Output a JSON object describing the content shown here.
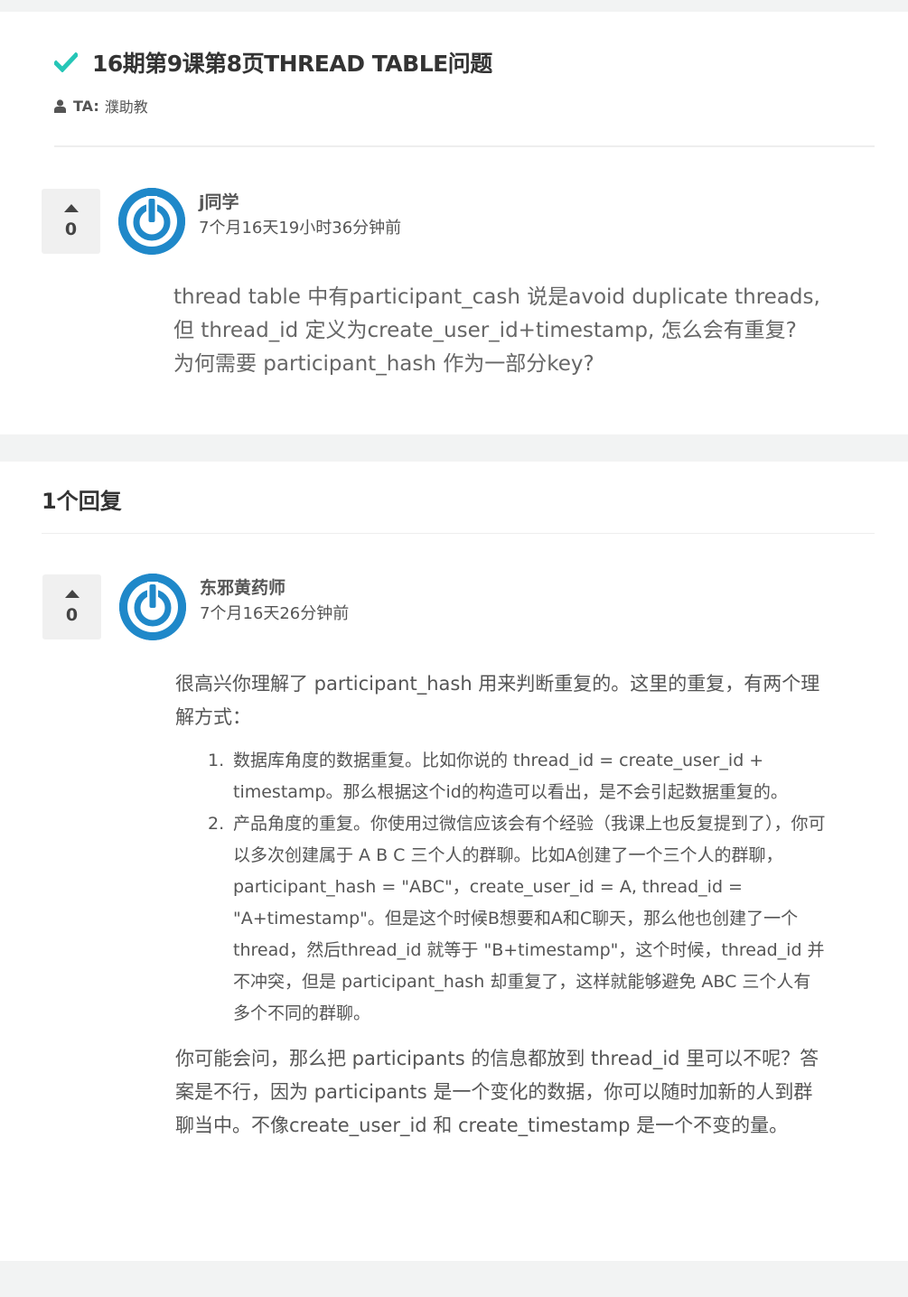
{
  "question": {
    "title": "16期第9课第8页THREAD TABLE问题",
    "ta_label": "TA:",
    "ta_name": "濮助教",
    "author": "j同学",
    "time": "7个月16天19小时36分钟前",
    "votes": "0",
    "body": "thread table 中有participant_cash 说是avoid duplicate threads, 但 thread_id 定义为create_user_id+timestamp, 怎么会有重复? 为何需要 participant_hash 作为一部分key?"
  },
  "answers_section": {
    "count_label": "1个回复"
  },
  "answer": {
    "author": "东邪黄药师",
    "time": "7个月16天26分钟前",
    "votes": "0",
    "intro": "很高兴你理解了 participant_hash 用来判断重复的。这里的重复，有两个理解方式：",
    "list": [
      {
        "num": "1.",
        "text": "数据库角度的数据重复。比如你说的 thread_id = create_user_id + timestamp。那么根据这个id的构造可以看出，是不会引起数据重复的。"
      },
      {
        "num": "2.",
        "text": "产品角度的重复。你使用过微信应该会有个经验（我课上也反复提到了），你可以多次创建属于 A B C 三个人的群聊。比如A创建了一个三个人的群聊，participant_hash = \"ABC\"，create_user_id = A, thread_id = \"A+timestamp\"。但是这个时候B想要和A和C聊天，那么他也创建了一个thread，然后thread_id 就等于 \"B+timestamp\"，这个时候，thread_id 并不冲突，但是 participant_hash 却重复了，这样就能够避免 ABC 三个人有多个不同的群聊。"
      }
    ],
    "outro": "你可能会问，那么把 participants 的信息都放到 thread_id 里可以不呢？答案是不行，因为 participants 是一个变化的数据，你可以随时加新的人到群聊当中。不像create_user_id 和 create_timestamp 是一个不变的量。"
  },
  "colors": {
    "check": "#26c6b7",
    "avatar": "#1f88c9",
    "page_bg": "#f2f3f3"
  },
  "icons": [
    "check-icon",
    "user-icon",
    "vote-up-icon",
    "avatar-power-icon"
  ]
}
